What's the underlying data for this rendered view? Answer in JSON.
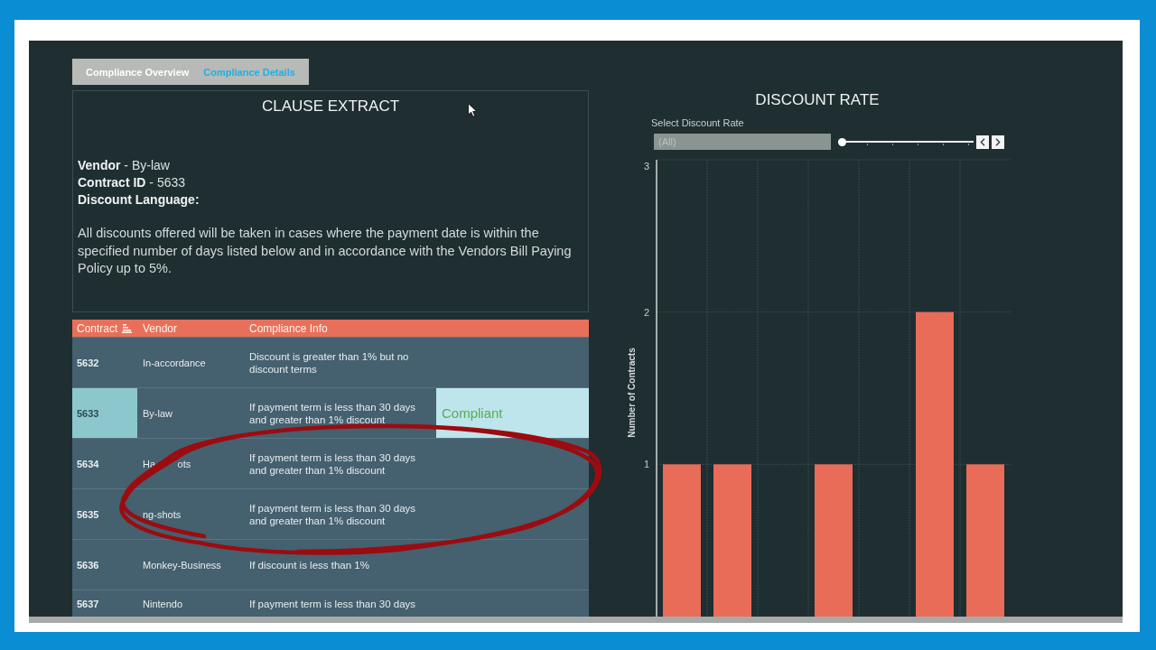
{
  "tabs": [
    {
      "label": "Compliance Overview",
      "selected": false
    },
    {
      "label": "Compliance Details",
      "selected": true
    }
  ],
  "clause_extract": {
    "title": "CLAUSE EXTRACT",
    "details": [
      "**Vendor** - By-law",
      "**Contract ID** - 5633"
    ],
    "language_label": "Discount Language:",
    "language_text": "All discounts offered will be taken in cases where the payment date is within the specified number of days listed below and in accordance with the Vendors Bill Paying Policy up to 5%."
  },
  "table": {
    "columns": [
      {
        "label": "Contract",
        "sorted": true
      },
      {
        "label": "Vendor",
        "sorted": false
      },
      {
        "label": "Compliance Info",
        "sorted": false
      }
    ],
    "rows": [
      {
        "contract": "5632",
        "vendor": "In-accordance",
        "info": "Discount is greater than 1% but no discount terms",
        "selected": false
      },
      {
        "contract": "5633",
        "vendor": "By-law",
        "info": "If payment term is less than 30 days and greater than 1% discount",
        "status": "Compliant",
        "selected": true
      },
      {
        "contract": "5634",
        "vendor": "Ha        ots",
        "info": "If payment term is less than 30 days and greater than 1% discount",
        "selected": false
      },
      {
        "contract": "5635",
        "vendor": "ng-shots",
        "info": "If payment term is less than 30 days and greater than 1% discount",
        "selected": false
      },
      {
        "contract": "5636",
        "vendor": "Monkey-Business",
        "info": "If discount is less than 1%",
        "selected": false
      },
      {
        "contract": "5637",
        "vendor": "Nintendo",
        "info": "If payment term is less than 30 days",
        "selected": false
      }
    ]
  },
  "discount_rate": {
    "title": "DISCOUNT RATE",
    "filter": {
      "label": "Select Discount Rate",
      "value": "(All)",
      "level": 0
    },
    "chart_data": {
      "type": "bar",
      "ylabel": "Number of Contracts",
      "categories": [
        null,
        null,
        null,
        null,
        null,
        null,
        null
      ],
      "values": [
        1,
        1,
        null,
        1,
        null,
        2,
        1
      ],
      "color": "#e96c58",
      "ylim": [
        0,
        3
      ],
      "yticks": [
        1,
        2,
        3
      ],
      "grid": true
    }
  }
}
